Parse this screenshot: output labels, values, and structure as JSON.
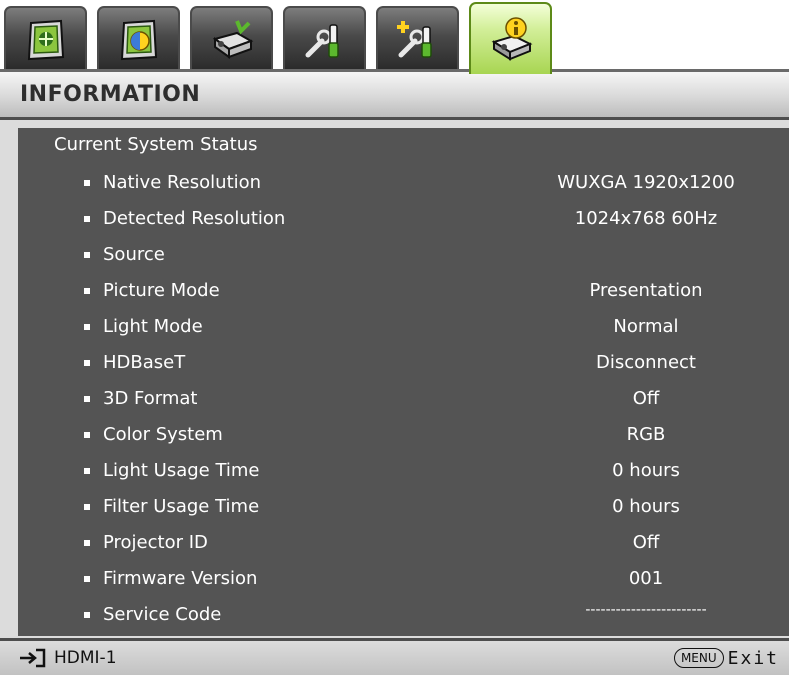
{
  "tabs": [
    {
      "name": "picture-tab",
      "icon": "picture-icon"
    },
    {
      "name": "display-tab",
      "icon": "display-icon"
    },
    {
      "name": "installation-tab",
      "icon": "installation-icon"
    },
    {
      "name": "system-setup-basic-tab",
      "icon": "system-setup-basic-icon"
    },
    {
      "name": "system-setup-advanced-tab",
      "icon": "system-setup-advanced-icon"
    },
    {
      "name": "information-tab",
      "icon": "information-icon",
      "active": true
    }
  ],
  "header": {
    "title": "INFORMATION"
  },
  "status": {
    "heading": "Current System Status",
    "rows": [
      {
        "label": "Native Resolution",
        "value": "WUXGA 1920x1200"
      },
      {
        "label": "Detected Resolution",
        "value": "1024x768 60Hz"
      },
      {
        "label": "Source",
        "value": ""
      },
      {
        "label": "Picture Mode",
        "value": "Presentation"
      },
      {
        "label": "Light Mode",
        "value": "Normal"
      },
      {
        "label": "HDBaseT",
        "value": "Disconnect"
      },
      {
        "label": "3D Format",
        "value": "Off"
      },
      {
        "label": "Color System",
        "value": "RGB"
      },
      {
        "label": "Light Usage Time",
        "value": "0 hours"
      },
      {
        "label": "Filter Usage Time",
        "value": "0 hours"
      },
      {
        "label": "Projector ID",
        "value": "Off"
      },
      {
        "label": "Firmware Version",
        "value": "001"
      },
      {
        "label": "Service Code",
        "value": "------------------------"
      }
    ]
  },
  "footer": {
    "source_icon": "input-source-icon",
    "source_label": "HDMI-1",
    "menu_key": "MENU",
    "exit_label": "Exit"
  },
  "colors": {
    "panel_background": "#545454",
    "active_tab": "#c6e882",
    "inactive_tab": "#4a4a4a",
    "text": "#ffffff"
  }
}
